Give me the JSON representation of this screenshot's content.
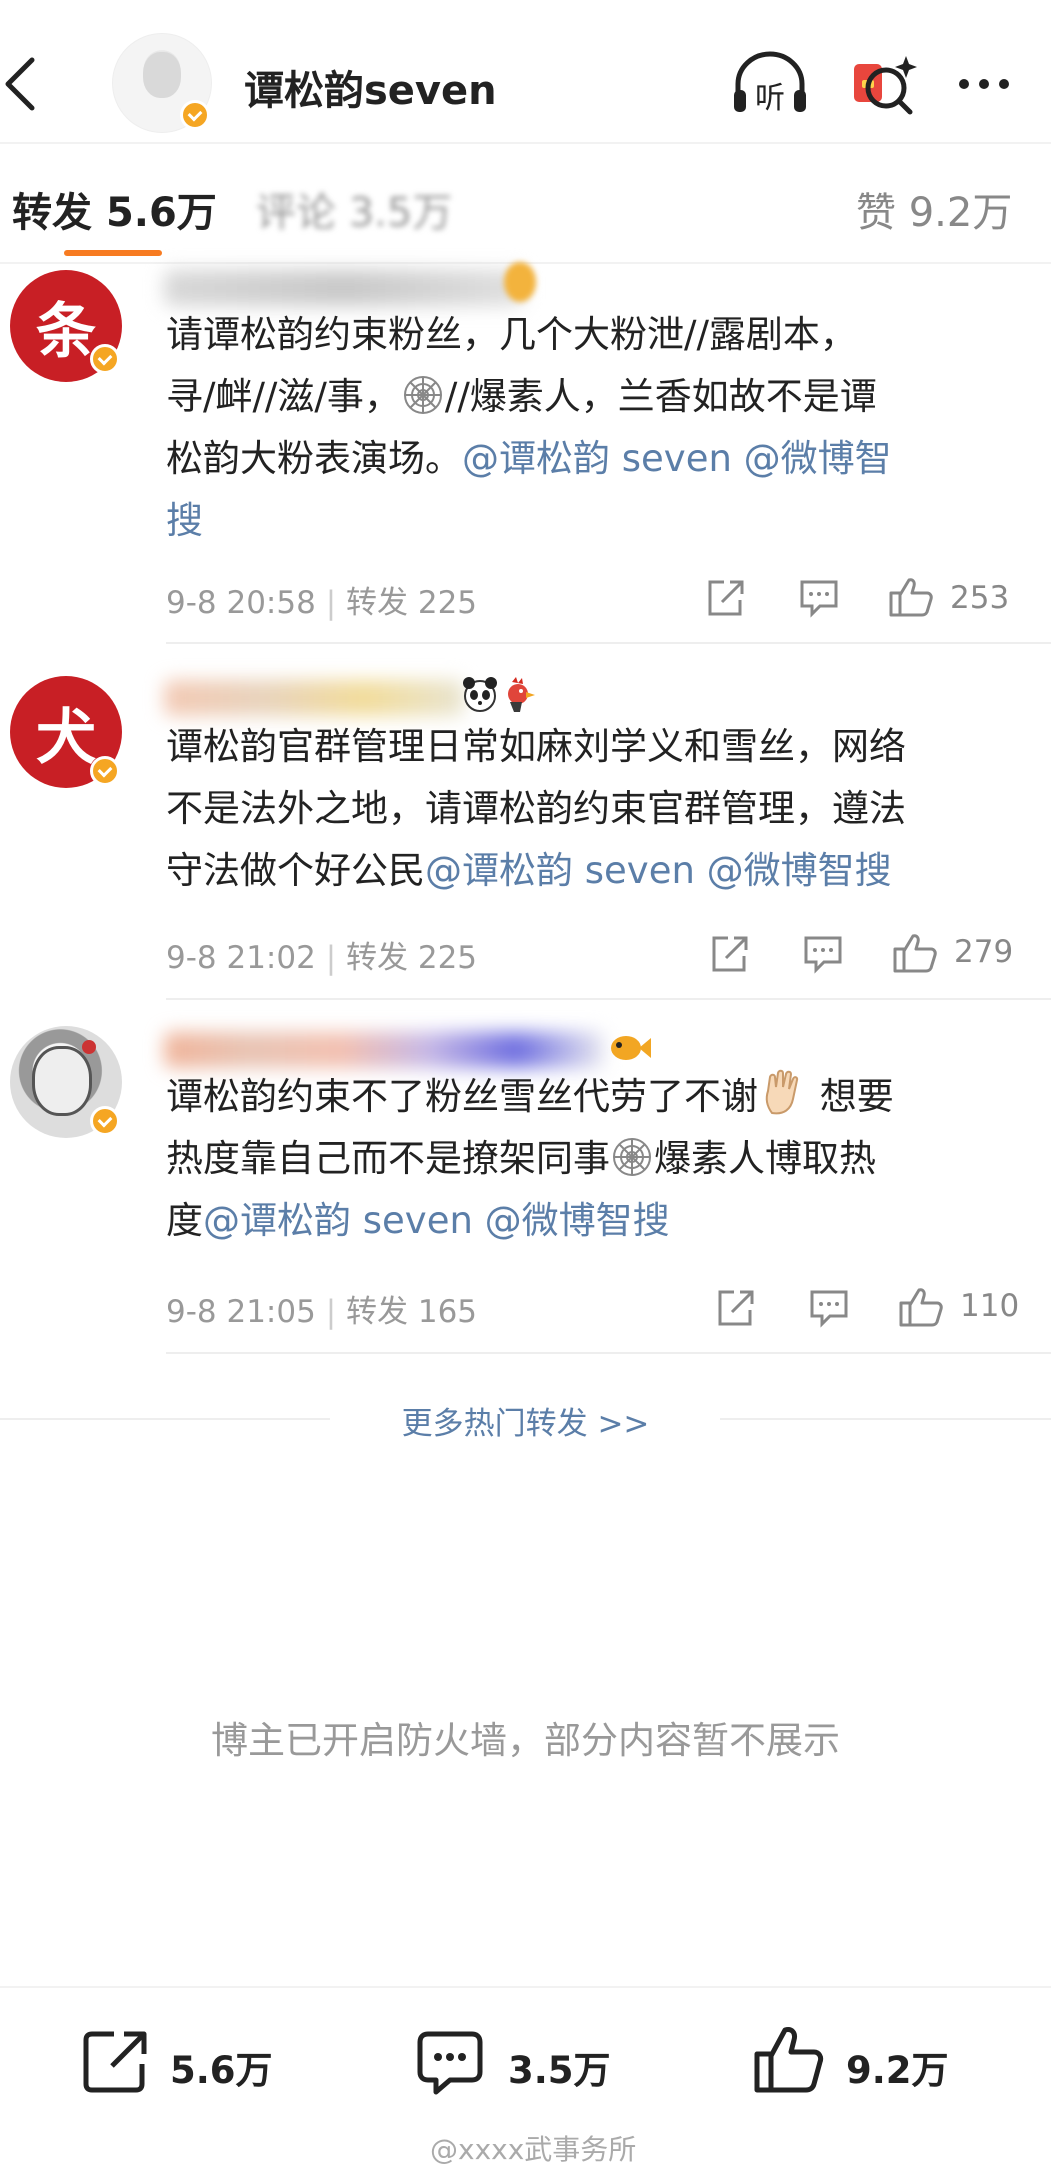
{
  "header": {
    "title": "谭松韵seven",
    "icons": [
      "back-arrow-icon",
      "listen-icon",
      "red-packet-search-icon",
      "more-icon"
    ],
    "listen_label": "听"
  },
  "tabs": [
    {
      "label": "转发",
      "count": "5.6万",
      "active": true
    },
    {
      "label": "评论",
      "count": "3.5万",
      "active": false
    },
    {
      "label": "赞",
      "count": "9.2万",
      "active": false
    }
  ],
  "comments": [
    {
      "avatar_char": "条",
      "lines": [
        "请谭松韵约束粉丝，几个大粉泄//露剧本，",
        "寻/衅//滋/事，",
        "//爆素人，兰香如故不是谭",
        "松韵大粉表演场。",
        "@谭松韵 seven @微博智",
        "搜"
      ],
      "date": "9-8 20:58",
      "repost": "转发 225",
      "likes": "253"
    },
    {
      "avatar_char": "犬",
      "lines": [
        "谭松韵官群管理日常如麻刘学义和雪丝，网络",
        "不是法外之地，请谭松韵约束官群管理，遵法",
        "守法做个好公民",
        "@谭松韵 seven @微博智搜"
      ],
      "date": "9-8 21:02",
      "repost": "转发 225",
      "likes": "279"
    },
    {
      "avatar_char": "",
      "lines": [
        "谭松韵约束不了粉丝雪丝代劳了不谢",
        "想要",
        "热度靠自己而不是撩架同事",
        "爆素人博取热",
        "度",
        "@谭松韵 seven @微博智搜"
      ],
      "date": "9-8 21:05",
      "repost": "转发 165",
      "likes": "110"
    }
  ],
  "more_link": "更多热门转发 >>",
  "notice": "博主已开启防火墙，部分内容暂不展示",
  "bottom_bar": {
    "repost": "5.6万",
    "comment": "3.5万",
    "like": "9.2万"
  },
  "watermark": "@xxxx武事务所"
}
